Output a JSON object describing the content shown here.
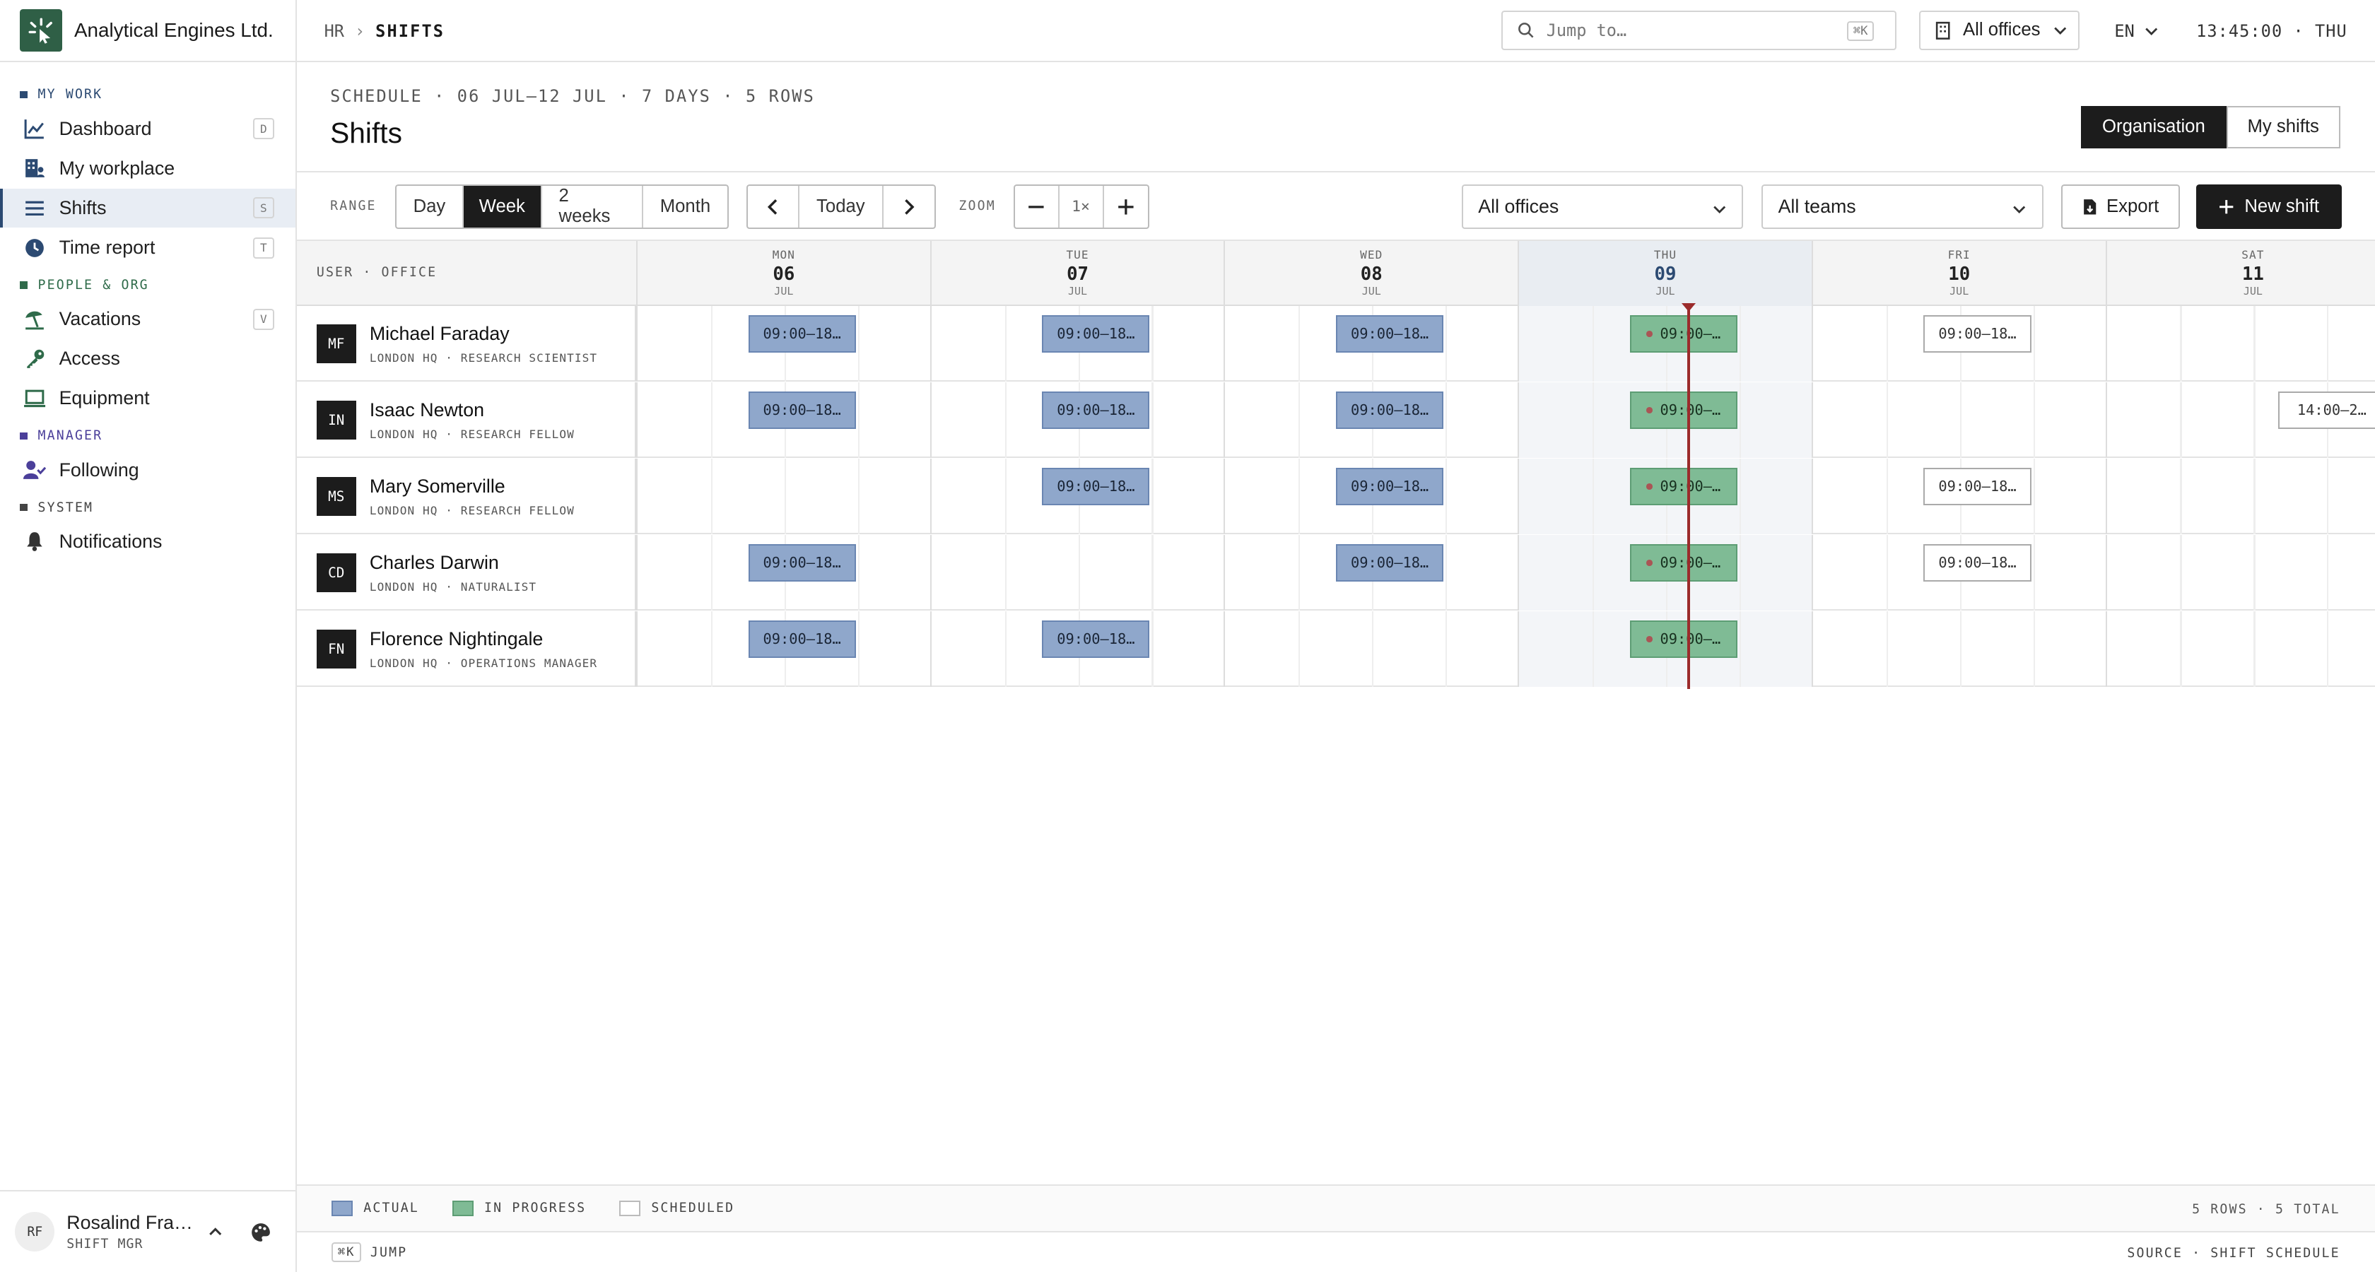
{
  "app": {
    "name": "Analytical Engines Ltd."
  },
  "sidebar": {
    "sections": [
      {
        "label": "MY WORK",
        "color": "#2c4a72",
        "items": [
          {
            "label": "Dashboard",
            "key": "D",
            "icon": "chart-line-icon"
          },
          {
            "label": "My workplace",
            "icon": "building-user-icon"
          },
          {
            "label": "Shifts",
            "key": "S",
            "icon": "list-icon",
            "active": true
          },
          {
            "label": "Time report",
            "key": "T",
            "icon": "clock-icon"
          }
        ]
      },
      {
        "label": "PEOPLE & ORG",
        "color": "#2f6b4a",
        "items": [
          {
            "label": "Vacations",
            "key": "V",
            "icon": "umbrella-beach-icon"
          },
          {
            "label": "Access",
            "icon": "key-icon"
          },
          {
            "label": "Equipment",
            "icon": "laptop-icon"
          }
        ]
      },
      {
        "label": "MANAGER",
        "color": "#4b3f9a",
        "items": [
          {
            "label": "Following",
            "icon": "user-check-icon"
          }
        ]
      },
      {
        "label": "SYSTEM",
        "color": "#444444",
        "items": [
          {
            "label": "Notifications",
            "icon": "bell-icon"
          }
        ]
      }
    ],
    "user": {
      "initials": "RF",
      "name": "Rosalind Franklin",
      "role": "SHIFT MGR"
    }
  },
  "topbar": {
    "crumb_parent": "HR",
    "crumb_current": "SHIFTS",
    "search_placeholder": "Jump to…",
    "search_key": "⌘K",
    "office_select": "All offices",
    "lang": "EN",
    "clock": "13:45:00 · THU"
  },
  "header": {
    "subtitle": "SCHEDULE · 06 JUL–12 JUL · 7 DAYS · 5 ROWS",
    "title": "Shifts",
    "views": [
      "Organisation",
      "My shifts"
    ]
  },
  "toolbar": {
    "range_label": "RANGE",
    "ranges": [
      "Day",
      "Week",
      "2 weeks",
      "Month"
    ],
    "today": "Today",
    "zoom_label": "ZOOM",
    "zoom": "1×",
    "offices": "All offices",
    "teams": "All teams",
    "export": "Export",
    "new_shift": "New shift"
  },
  "grid": {
    "user_header": "USER · OFFICE",
    "days": [
      {
        "dow": "MON",
        "date": "06",
        "month": "JUL"
      },
      {
        "dow": "TUE",
        "date": "07",
        "month": "JUL"
      },
      {
        "dow": "WED",
        "date": "08",
        "month": "JUL"
      },
      {
        "dow": "THU",
        "date": "09",
        "month": "JUL",
        "today": true
      },
      {
        "dow": "FRI",
        "date": "10",
        "month": "JUL"
      },
      {
        "dow": "SAT",
        "date": "11",
        "month": "JUL"
      }
    ],
    "rows": [
      {
        "initials": "MF",
        "name": "Michael Faraday",
        "office": "LONDON HQ · RESEARCH SCIENTIST",
        "shifts": [
          {
            "day": 0,
            "label": "09:00–18…",
            "type": "actual"
          },
          {
            "day": 1,
            "label": "09:00–18…",
            "type": "actual"
          },
          {
            "day": 2,
            "label": "09:00–18…",
            "type": "actual"
          },
          {
            "day": 3,
            "label": "09:00–…",
            "type": "prog"
          },
          {
            "day": 4,
            "label": "09:00–18…",
            "type": "sched"
          }
        ]
      },
      {
        "initials": "IN",
        "name": "Isaac Newton",
        "office": "LONDON HQ · RESEARCH FELLOW",
        "shifts": [
          {
            "day": 0,
            "label": "09:00–18…",
            "type": "actual"
          },
          {
            "day": 1,
            "label": "09:00–18…",
            "type": "actual"
          },
          {
            "day": 2,
            "label": "09:00–18…",
            "type": "actual"
          },
          {
            "day": 3,
            "label": "09:00–…",
            "type": "prog"
          },
          {
            "day": 5,
            "label": "14:00–2…",
            "type": "sched",
            "late": true
          }
        ]
      },
      {
        "initials": "MS",
        "name": "Mary Somerville",
        "office": "LONDON HQ · RESEARCH FELLOW",
        "shifts": [
          {
            "day": 1,
            "label": "09:00–18…",
            "type": "actual"
          },
          {
            "day": 2,
            "label": "09:00–18…",
            "type": "actual"
          },
          {
            "day": 3,
            "label": "09:00–…",
            "type": "prog"
          },
          {
            "day": 4,
            "label": "09:00–18…",
            "type": "sched"
          }
        ]
      },
      {
        "initials": "CD",
        "name": "Charles Darwin",
        "office": "LONDON HQ · NATURALIST",
        "shifts": [
          {
            "day": 0,
            "label": "09:00–18…",
            "type": "actual"
          },
          {
            "day": 2,
            "label": "09:00–18…",
            "type": "actual"
          },
          {
            "day": 3,
            "label": "09:00–…",
            "type": "prog"
          },
          {
            "day": 4,
            "label": "09:00–18…",
            "type": "sched"
          }
        ]
      },
      {
        "initials": "FN",
        "name": "Florence Nightingale",
        "office": "LONDON HQ · OPERATIONS MANAGER",
        "shifts": [
          {
            "day": 0,
            "label": "09:00–18…",
            "type": "actual"
          },
          {
            "day": 1,
            "label": "09:00–18…",
            "type": "actual"
          },
          {
            "day": 3,
            "label": "09:00–…",
            "type": "prog"
          }
        ]
      }
    ]
  },
  "legend": {
    "items": [
      {
        "label": "ACTUAL",
        "type": "actual"
      },
      {
        "label": "IN PROGRESS",
        "type": "prog"
      },
      {
        "label": "SCHEDULED",
        "type": "sched"
      }
    ],
    "count": "5 ROWS · 5 TOTAL"
  },
  "footer": {
    "key": "⌘K",
    "jump": "JUMP",
    "source": "SOURCE · SHIFT SCHEDULE"
  }
}
